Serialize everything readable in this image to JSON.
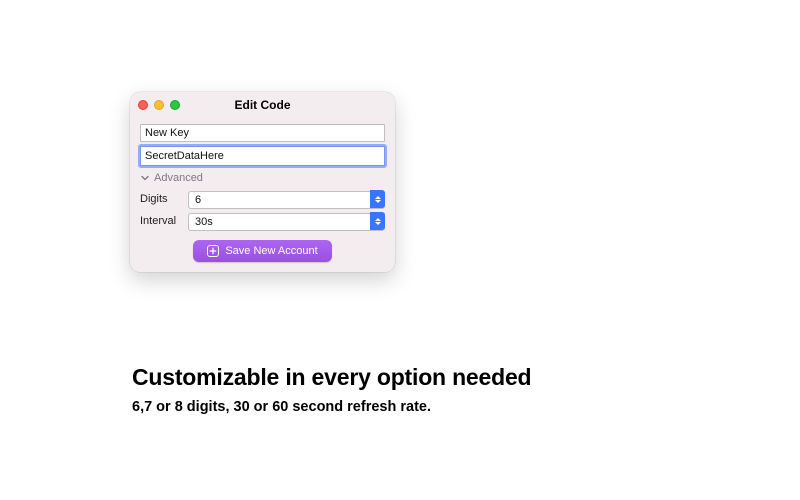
{
  "window": {
    "title": "Edit Code",
    "name_value": "New Key",
    "secret_value": "SecretDataHere",
    "advanced_label": "Advanced",
    "fields": {
      "digits_label": "Digits",
      "digits_value": "6",
      "interval_label": "Interval",
      "interval_value": "30s"
    },
    "save_button_label": "Save New Account"
  },
  "marketing": {
    "headline": "Customizable in every option needed",
    "subhead": "6,7 or 8 digits, 30 or 60 second refresh rate."
  },
  "colors": {
    "button_purple": "#a15be8",
    "stepper_blue": "#3b74ff"
  }
}
